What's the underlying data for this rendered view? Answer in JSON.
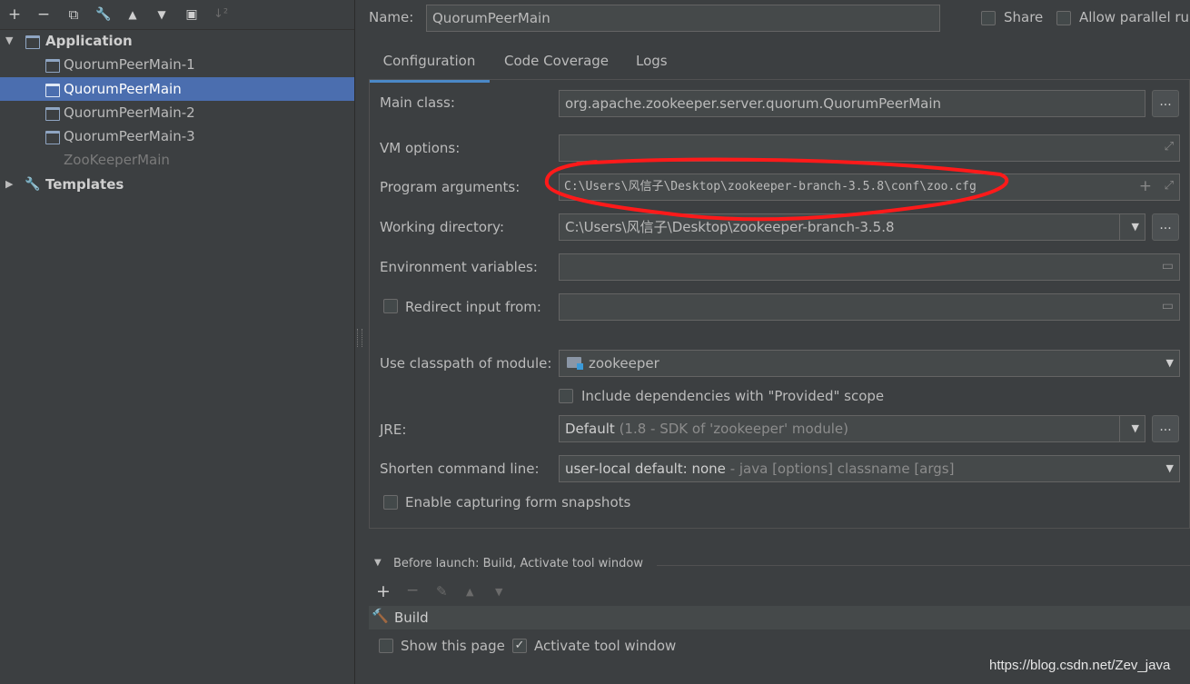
{
  "toolbar": {
    "add": "+",
    "remove": "−",
    "copy": "⧉",
    "edit": "🔧",
    "up": "▲",
    "down": "▼",
    "folder": "▣",
    "sort": "↓²"
  },
  "tree": {
    "application": "Application",
    "items": [
      {
        "label": "QuorumPeerMain-1"
      },
      {
        "label": "QuorumPeerMain"
      },
      {
        "label": "QuorumPeerMain-2"
      },
      {
        "label": "QuorumPeerMain-3"
      },
      {
        "label": "ZooKeeperMain"
      }
    ],
    "templates": "Templates"
  },
  "header": {
    "name_label": "Name:",
    "name_value": "QuorumPeerMain",
    "share_label": "Share",
    "allow_parallel_label": "Allow parallel run"
  },
  "tabs": [
    "Configuration",
    "Code Coverage",
    "Logs"
  ],
  "form": {
    "main_class_label": "Main class:",
    "main_class_value": "org.apache.zookeeper.server.quorum.QuorumPeerMain",
    "vm_options_label": "VM options:",
    "vm_options_value": "",
    "program_args_label": "Program arguments:",
    "program_args_value": "C:\\Users\\风信子\\Desktop\\zookeeper-branch-3.5.8\\conf\\zoo.cfg",
    "working_dir_label": "Working directory:",
    "working_dir_value": "C:\\Users\\风信子\\Desktop\\zookeeper-branch-3.5.8",
    "env_vars_label": "Environment variables:",
    "env_vars_value": "",
    "redirect_label": "Redirect input from:",
    "redirect_value": "",
    "classpath_label": "Use classpath of module:",
    "classpath_value": "zookeeper",
    "include_deps_label": "Include dependencies with \"Provided\" scope",
    "jre_label": "JRE:",
    "jre_main": "Default",
    "jre_detail": " (1.8 - SDK of 'zookeeper' module)",
    "shorten_label": "Shorten command line:",
    "shorten_main": "user-local default: none",
    "shorten_detail": " - java [options] classname [args]",
    "snapshots_label": "Enable capturing form snapshots",
    "ellipsis": "..."
  },
  "before_launch": {
    "title": "Before launch: Build, Activate tool window",
    "build_label": "Build",
    "show_page_label": "Show this page",
    "activate_label": "Activate tool window",
    "activate_checked": true
  },
  "watermark": "https://blog.csdn.net/Zev_java",
  "colors": {
    "selection": "#4b6eaf",
    "accent_tab": "#4a88c7",
    "annotation": "#ff1a1a",
    "build_icon": "#4caf50"
  }
}
